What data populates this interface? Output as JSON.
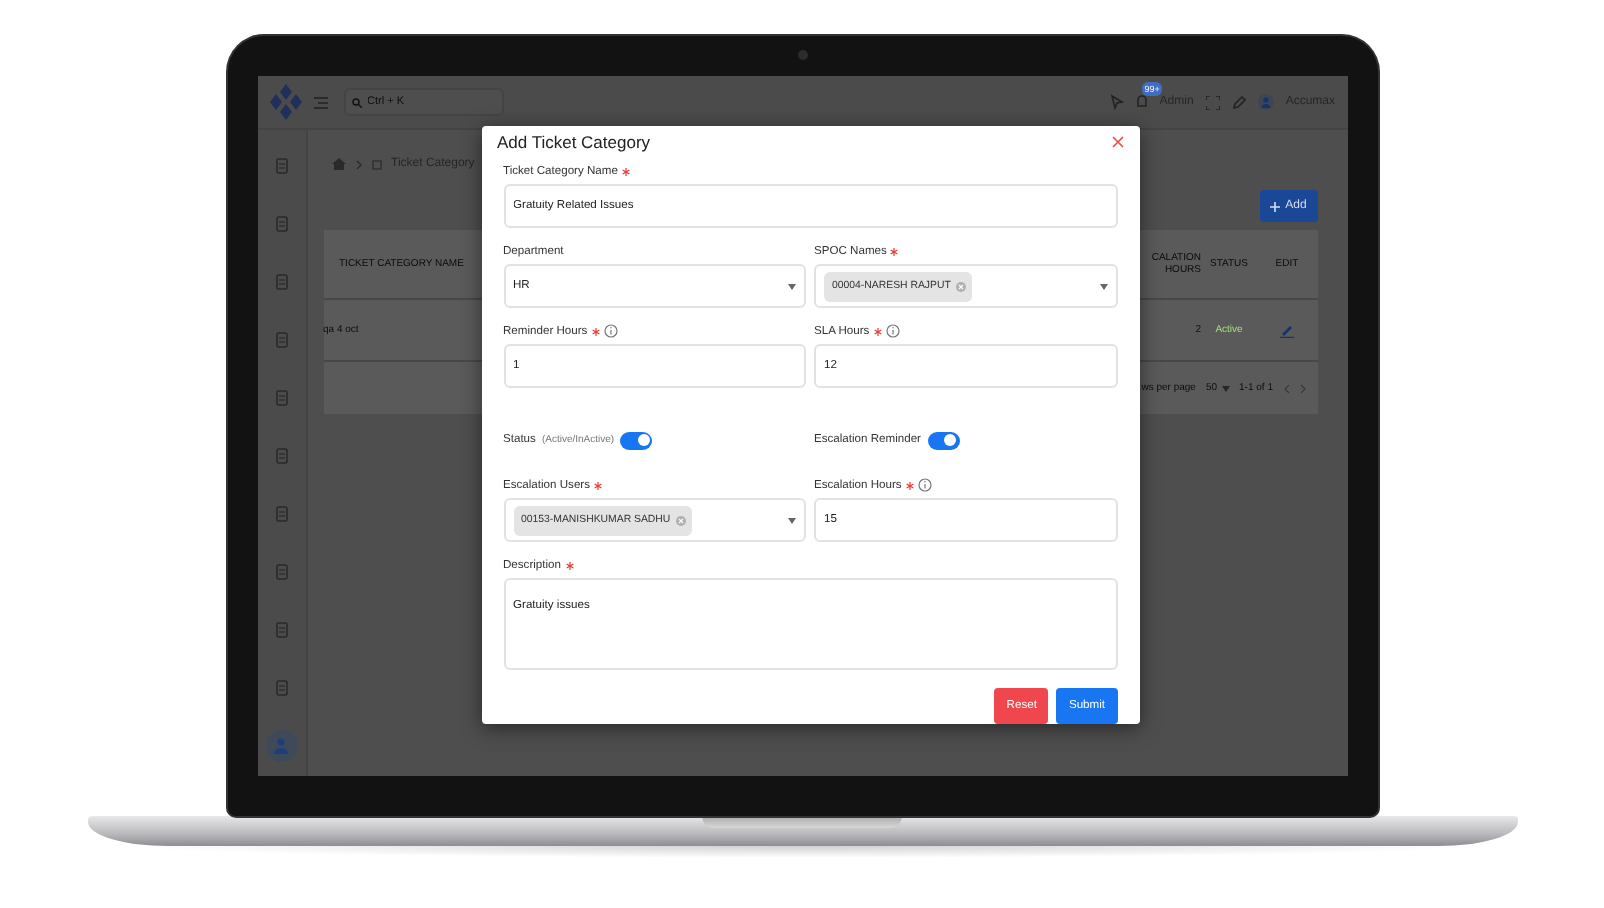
{
  "topbar": {
    "search": {
      "placeholder": "Ctrl + K"
    },
    "notification_badge": "99+",
    "role": "Admin",
    "user": "Accumax"
  },
  "sidebar": {
    "items": [
      {
        "selected": false
      },
      {
        "selected": false
      },
      {
        "selected": false
      },
      {
        "selected": false
      },
      {
        "selected": false
      },
      {
        "selected": false
      },
      {
        "selected": false
      },
      {
        "selected": false
      },
      {
        "selected": false
      },
      {
        "selected": false
      },
      {
        "selected": true
      }
    ]
  },
  "breadcrumb": [
    "Ticket Category"
  ],
  "add_button": "Add",
  "table": {
    "columns": [
      "TICKET CATEGORY NAME",
      "CALATION HOURS",
      "STATUS",
      "EDIT"
    ],
    "rows": [
      {
        "name": "qa 4 oct",
        "escalation_hours": "2",
        "status": "Active"
      }
    ]
  },
  "pagination": {
    "rows_per_page_label": "ws per page",
    "rows_per_page": "50",
    "range": "1-1 of 1"
  },
  "modal": {
    "title": "Add Ticket Category",
    "rows": [
      [
        {
          "kind": "text",
          "label": "Ticket Category Name",
          "required": true,
          "info": false,
          "value": "Gratuity Related Issues"
        }
      ],
      [
        {
          "kind": "select",
          "label": "Department",
          "required": false,
          "info": false,
          "value": "HR"
        },
        {
          "kind": "multiselect",
          "label": "SPOC Names",
          "required": true,
          "info": false,
          "chips": [
            "00004-NARESH RAJPUT"
          ]
        }
      ],
      [
        {
          "kind": "text",
          "label": "Reminder Hours",
          "required": true,
          "info": true,
          "value": "1"
        },
        {
          "kind": "text",
          "label": "SLA Hours",
          "required": true,
          "info": true,
          "value": "12"
        }
      ],
      [
        {
          "kind": "toggle",
          "label": "Status",
          "hint": "(Active/InActive)",
          "on": true
        },
        {
          "kind": "toggle",
          "label": "Escalation Reminder",
          "on": true
        }
      ],
      [
        {
          "kind": "multiselect",
          "label": "Escalation Users",
          "required": true,
          "info": false,
          "chips": [
            "00153-MANISHKUMAR SADHU"
          ]
        },
        {
          "kind": "text",
          "label": "Escalation Hours",
          "required": true,
          "info": true,
          "value": "15"
        }
      ],
      [
        {
          "kind": "textarea",
          "label": "Description",
          "required": true,
          "info": false,
          "value": "Gratuity issues"
        }
      ]
    ],
    "buttons": [
      {
        "kind": "reset",
        "label": "Reset"
      },
      {
        "kind": "submit",
        "label": "Submit"
      }
    ]
  }
}
